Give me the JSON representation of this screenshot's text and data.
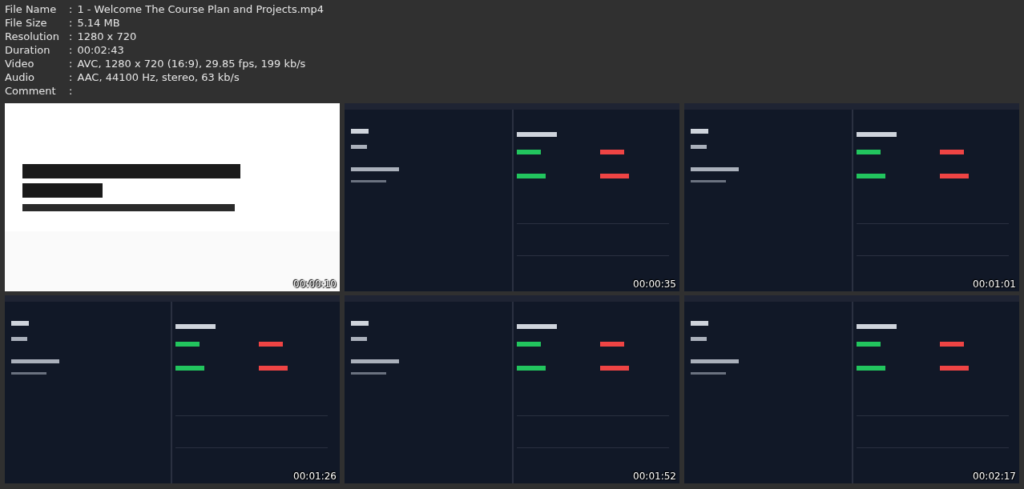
{
  "info": [
    {
      "label": "File Name",
      "separator": ":",
      "value": "1 - Welcome The Course Plan and Projects.mp4"
    },
    {
      "label": "File Size",
      "separator": ":",
      "value": "5.14 MB"
    },
    {
      "label": "Resolution",
      "separator": ":",
      "value": "1280 x 720"
    },
    {
      "label": "Duration",
      "separator": ":",
      "value": "00:02:43"
    },
    {
      "label": "Video",
      "separator": ":",
      "value": "AVC, 1280 x 720 (16:9), 29.85 fps, 199 kb/s"
    },
    {
      "label": "Audio",
      "separator": ":",
      "value": "AAC, 44100 Hz, stereo, 63 kb/s"
    },
    {
      "label": "Comment",
      "separator": ":"
    }
  ],
  "frames": [
    {
      "kind": "picture",
      "timestamp": "00:00:10"
    },
    {
      "kind": "picture",
      "timestamp": "00:00:35"
    },
    {
      "kind": "picture",
      "timestamp": "00:01:01"
    },
    {
      "kind": "picture",
      "timestamp": "00:01:26"
    },
    {
      "kind": "picture",
      "timestamp": "00:01:52"
    },
    {
      "kind": "picture",
      "timestamp": "00:02:17"
    }
  ]
}
